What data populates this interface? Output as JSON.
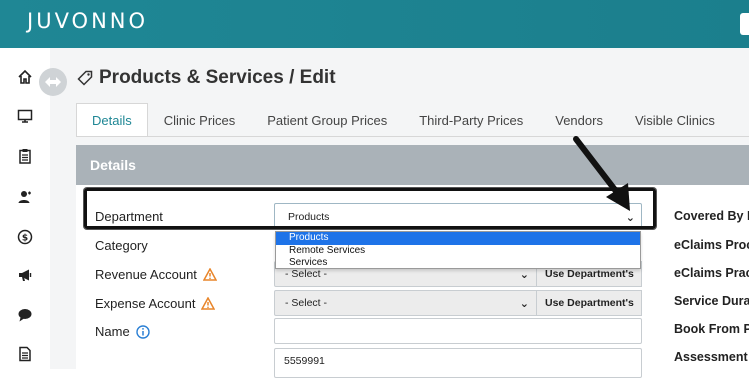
{
  "app": {
    "logo_text": "JUVONNO",
    "brand_color": "#1f8795"
  },
  "sidebar": {
    "items": [
      {
        "icon": "home-icon"
      },
      {
        "icon": "monitor-icon"
      },
      {
        "icon": "clipboard-icon"
      },
      {
        "icon": "users-icon"
      },
      {
        "icon": "dollar-icon"
      },
      {
        "icon": "megaphone-icon"
      },
      {
        "icon": "chat-icon"
      },
      {
        "icon": "document-icon"
      }
    ]
  },
  "page": {
    "title": "Products & Services / Edit"
  },
  "tabs": [
    {
      "label": "Details",
      "active": true
    },
    {
      "label": "Clinic Prices",
      "active": false
    },
    {
      "label": "Patient Group Prices",
      "active": false
    },
    {
      "label": "Third-Party Prices",
      "active": false
    },
    {
      "label": "Vendors",
      "active": false
    },
    {
      "label": "Visible Clinics",
      "active": false
    }
  ],
  "panel": {
    "heading": "Details"
  },
  "form": {
    "department_label": "Department",
    "department_value": "Products",
    "department_options": [
      "Products",
      "Remote Services",
      "Services"
    ],
    "category_label": "Category",
    "revenue_label": "Revenue Account",
    "revenue_value": "- Select -",
    "revenue_button": "Use Department's",
    "expense_label": "Expense Account",
    "expense_value": "- Select -",
    "expense_button": "Use Department's",
    "name_label": "Name",
    "name_value": "",
    "item_value": "5559991"
  },
  "right_labels": {
    "covered": "Covered By In",
    "eclaims_proc": "eClaims Proce",
    "eclaims_pract": "eClaims Pract",
    "service_dur": "Service Durati",
    "book_from": "Book From Po",
    "assessment": "Assessment"
  }
}
